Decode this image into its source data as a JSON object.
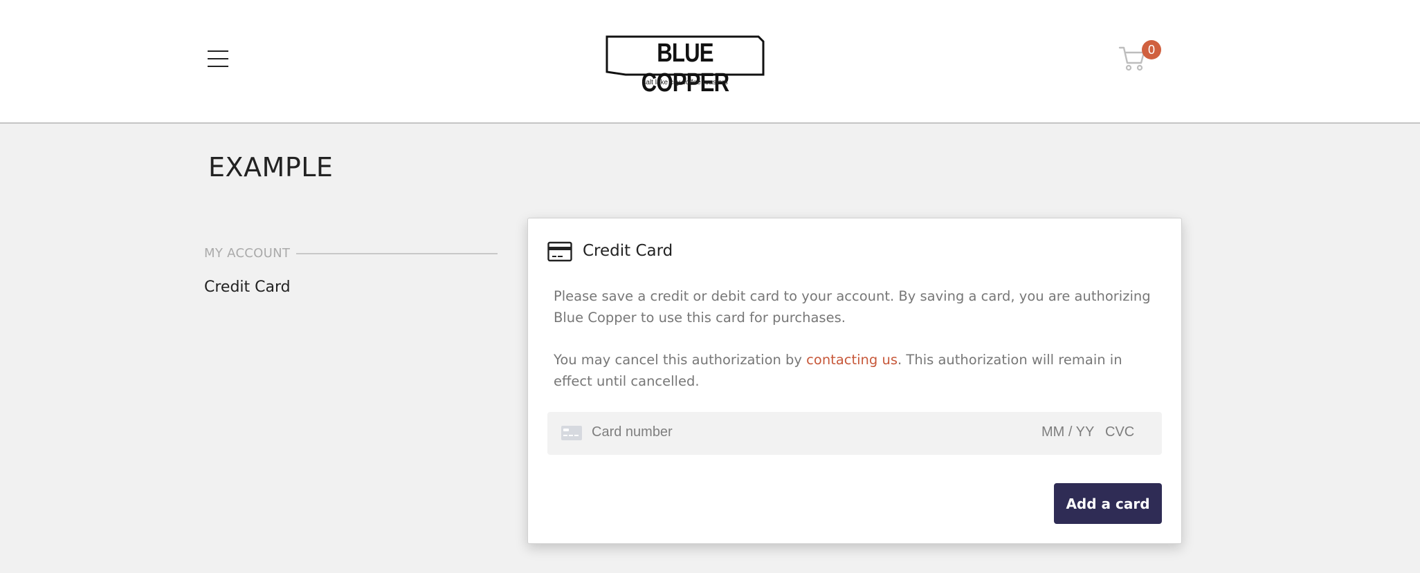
{
  "header": {
    "menu_icon": "hamburger-menu-icon",
    "logo": {
      "text": "BLUE COPPER",
      "tagline": "salt lake city coffee roasters"
    },
    "cart": {
      "icon": "shopping-cart-icon",
      "count": "0"
    }
  },
  "page": {
    "title": "EXAMPLE"
  },
  "sidebar": {
    "heading": "MY ACCOUNT",
    "items": [
      {
        "label": "Credit Card"
      }
    ]
  },
  "credit_card_panel": {
    "icon": "credit-card-icon",
    "title": "Credit Card",
    "paragraph_1": "Please save a credit or debit card to your account. By saving a card, you are authorizing Blue Copper to use this card for purchases.",
    "paragraph_2_before": "You may cancel this authorization by ",
    "paragraph_2_link": "contacting us",
    "paragraph_2_after": ". This authorization will remain in effect until cancelled.",
    "card_field": {
      "icon": "card-placeholder-icon",
      "number_placeholder": "Card number",
      "expiry_placeholder": "MM / YY",
      "cvc_placeholder": "CVC"
    },
    "add_button_label": "Add a card"
  },
  "colors": {
    "accent": "#d0603f",
    "link": "#c7583a",
    "button": "#2f2c55",
    "background": "#f1f1f1"
  }
}
